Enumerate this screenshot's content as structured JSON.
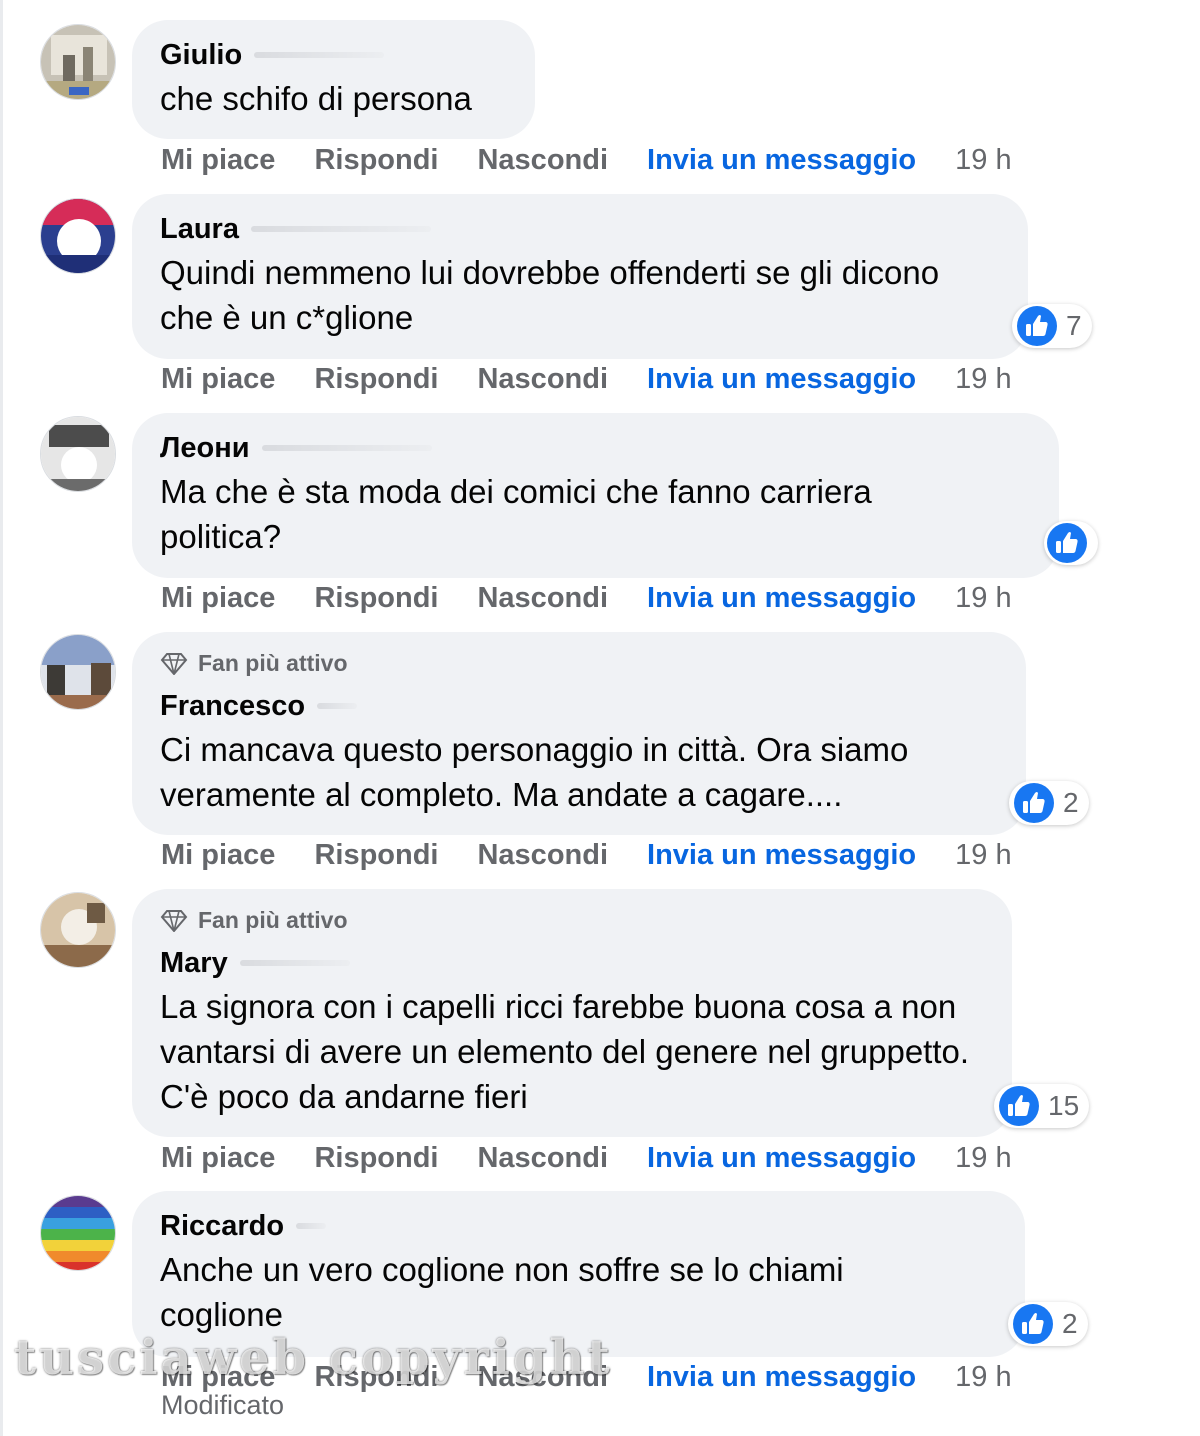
{
  "colors": {
    "bubble": "#f0f2f5",
    "link": "#0866e0",
    "meta": "#65676b",
    "like": "#1877f2"
  },
  "actions": {
    "like": "Mi piace",
    "reply": "Rispondi",
    "hide": "Nascondi",
    "message": "Invia un messaggio"
  },
  "comments": [
    {
      "author": "Giulio",
      "badge": "",
      "text": "che schifo di persona",
      "likes": "",
      "time": "19 h"
    },
    {
      "author": "Laura",
      "badge": "",
      "text": "Quindi nemmeno lui dovrebbe offenderti se gli dicono che è un c*glione",
      "likes": "7",
      "time": "19 h"
    },
    {
      "author": "Леони",
      "badge": "",
      "text": "Ma che è sta moda dei comici che fanno carriera politica?",
      "likes": "",
      "time": "19 h"
    },
    {
      "author": "Francesco",
      "badge": "Fan più attivo",
      "text": "Ci mancava questo personaggio in città. Ora siamo veramente al completo. Ma andate a cagare....",
      "likes": "2",
      "time": "19 h"
    },
    {
      "author": "Mary",
      "badge": "Fan più attivo",
      "text": "La signora con i capelli ricci farebbe buona cosa a non vantarsi di avere un elemento del genere nel gruppetto. C'è poco da andarne fieri",
      "likes": "15",
      "time": "19 h"
    },
    {
      "author": "Riccardo",
      "badge": "",
      "text": "Anche un vero coglione non soffre se lo chiami coglione",
      "likes": "2",
      "time": "19 h"
    }
  ],
  "edited_label": "Modificato",
  "watermark": "tusciaweb copyright",
  "icons": {
    "like": "thumbs-up-icon",
    "badge": "diamond-icon"
  }
}
